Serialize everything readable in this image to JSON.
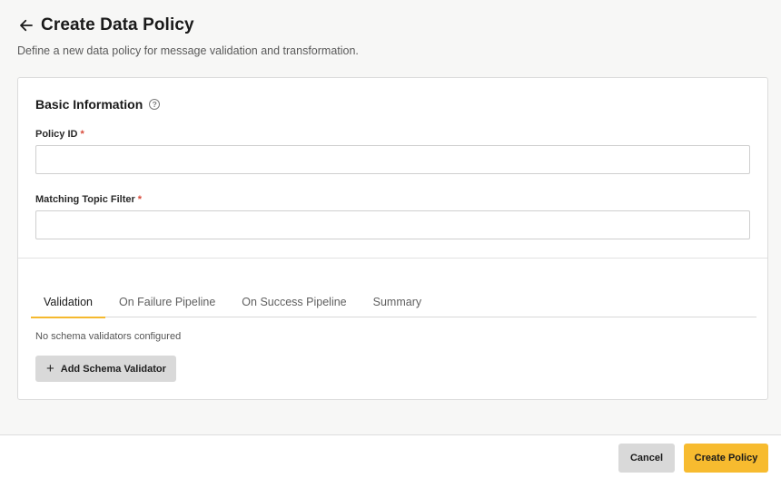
{
  "header": {
    "title": "Create Data Policy",
    "subtitle": "Define a new data policy for message validation and transformation.",
    "back_icon": "arrow-left-icon"
  },
  "basic_info": {
    "title": "Basic Information",
    "help_icon": "help-circle-icon",
    "help_glyph": "?",
    "policy_id": {
      "label": "Policy ID",
      "required_mark": "*",
      "value": "",
      "placeholder": ""
    },
    "topic_filter": {
      "label": "Matching Topic Filter",
      "required_mark": "*",
      "value": "",
      "placeholder": ""
    }
  },
  "tabs": [
    {
      "label": "Validation",
      "active": true
    },
    {
      "label": "On Failure Pipeline",
      "active": false
    },
    {
      "label": "On Success Pipeline",
      "active": false
    },
    {
      "label": "Summary",
      "active": false
    }
  ],
  "validation": {
    "empty_text": "No schema validators configured",
    "add_button": {
      "icon": "plus-icon",
      "glyph": "+",
      "label": "Add Schema Validator"
    }
  },
  "footer": {
    "cancel_label": "Cancel",
    "create_label": "Create Policy"
  },
  "colors": {
    "accent": "#f5b92e",
    "primary_button": "#f7bb2f",
    "secondary_button": "#d9d9d9",
    "required": "#d84a3a"
  }
}
